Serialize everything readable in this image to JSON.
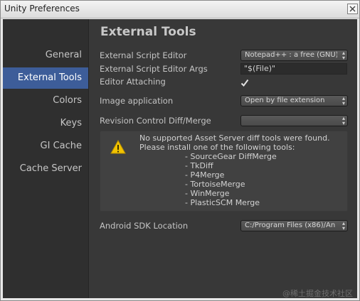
{
  "window": {
    "title": "Unity Preferences"
  },
  "sidebar": {
    "items": [
      {
        "label": "General",
        "selected": false
      },
      {
        "label": "External Tools",
        "selected": true
      },
      {
        "label": "Colors",
        "selected": false
      },
      {
        "label": "Keys",
        "selected": false
      },
      {
        "label": "GI Cache",
        "selected": false
      },
      {
        "label": "Cache Server",
        "selected": false
      }
    ]
  },
  "main": {
    "heading": "External Tools",
    "external_script_editor": {
      "label": "External Script Editor",
      "value": "Notepad++ : a free (GNU)"
    },
    "external_script_editor_args": {
      "label": "External Script Editor Args",
      "value": "\"$(File)\""
    },
    "editor_attaching": {
      "label": "Editor Attaching",
      "checked": true
    },
    "image_application": {
      "label": "Image application",
      "value": "Open by file extension"
    },
    "revision_control": {
      "label": "Revision Control Diff/Merge",
      "value": ""
    },
    "help_box": {
      "icon": "warning-icon",
      "line1": "No supported Asset Server diff tools were found.",
      "line2": "Please install one of the following tools:",
      "tools": [
        "- SourceGear DiffMerge",
        "- TkDiff",
        "- P4Merge",
        "- TortoiseMerge",
        "- WinMerge",
        "- PlasticSCM Merge"
      ]
    },
    "android_sdk": {
      "label": "Android SDK Location",
      "value": "C:/Program Files (x86)/An"
    }
  },
  "watermark": "@稀土掘金技术社区",
  "colors": {
    "selected_bg": "#3d5d99",
    "panel_bg": "#383838",
    "sidebar_bg": "#2f2f2f",
    "warning": "#f2c300"
  }
}
